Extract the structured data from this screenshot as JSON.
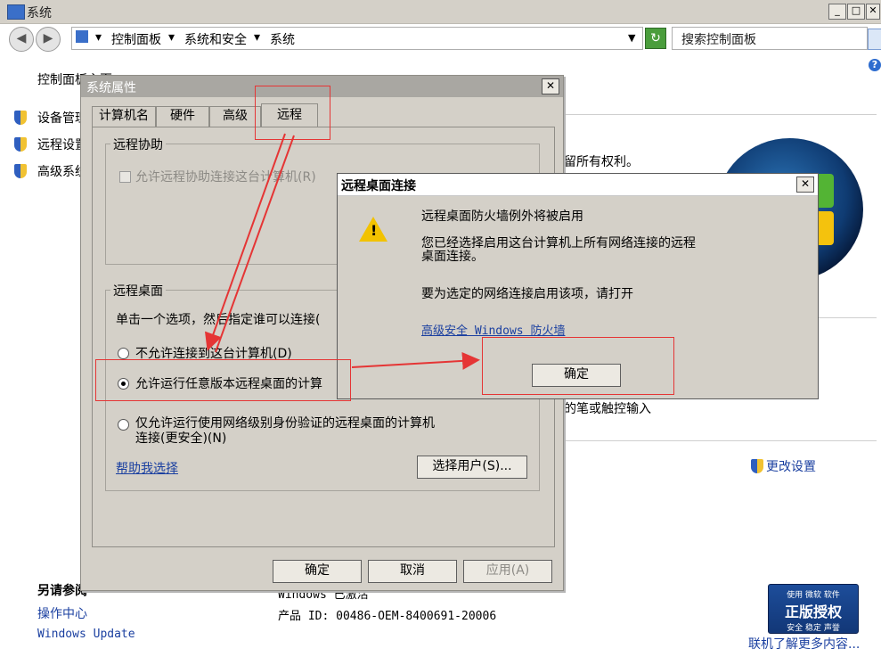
{
  "window": {
    "title": "系统"
  },
  "nav": {
    "breadcrumb": [
      "控制面板",
      "系统和安全",
      "系统"
    ],
    "search_placeholder": "搜索控制面板"
  },
  "sidebar": {
    "home": "控制面板主页",
    "links": [
      "设备管理器",
      "远程设置",
      "高级系统设置"
    ]
  },
  "see_also": {
    "title": "另请参阅",
    "links": [
      "操作中心",
      "Windows Update"
    ]
  },
  "main": {
    "copyright_frag": "留所有权利。",
    "pen_frag": "的笔或触控输入",
    "change_settings": "更改设置",
    "activation_frag": "Windows 已激活",
    "product_id": "产品 ID: 00486-OEM-8400691-20006",
    "more_link": "联机了解更多内容...",
    "badge": {
      "top": "使用 微软 软件",
      "main": "正版授权",
      "sub": "安全 稳定 声誉"
    }
  },
  "sysprops": {
    "title": "系统属性",
    "tabs": [
      "计算机名",
      "硬件",
      "高级",
      "远程"
    ],
    "remote_assist": {
      "label": "远程协助",
      "checkbox": "允许远程协助连接这台计算机(R)"
    },
    "remote_desktop": {
      "label": "远程桌面",
      "hint": "单击一个选项，然后指定谁可以连接(",
      "opt1": "不允许连接到这台计算机(D)",
      "opt2": "允许运行任意版本远程桌面的计算",
      "opt3_l1": "仅允许运行使用网络级别身份验证的远程桌面的计算机",
      "opt3_l2": "连接(更安全)(N)",
      "help": "帮助我选择",
      "select_users": "选择用户(S)..."
    },
    "buttons": {
      "ok": "确定",
      "cancel": "取消",
      "apply": "应用(A)"
    }
  },
  "rdp_dialog": {
    "title": "远程桌面连接",
    "heading": "远程桌面防火墙例外将被启用",
    "body_l1": "您已经选择启用这台计算机上所有网络连接的远程",
    "body_l2": "桌面连接。",
    "instruction": "要为选定的网络连接启用该项，请打开",
    "link": "高级安全 Windows 防火墙",
    "ok": "确定"
  },
  "colors": {
    "annotation_red": "#e53535",
    "link_blue": "#1a3fa0"
  }
}
